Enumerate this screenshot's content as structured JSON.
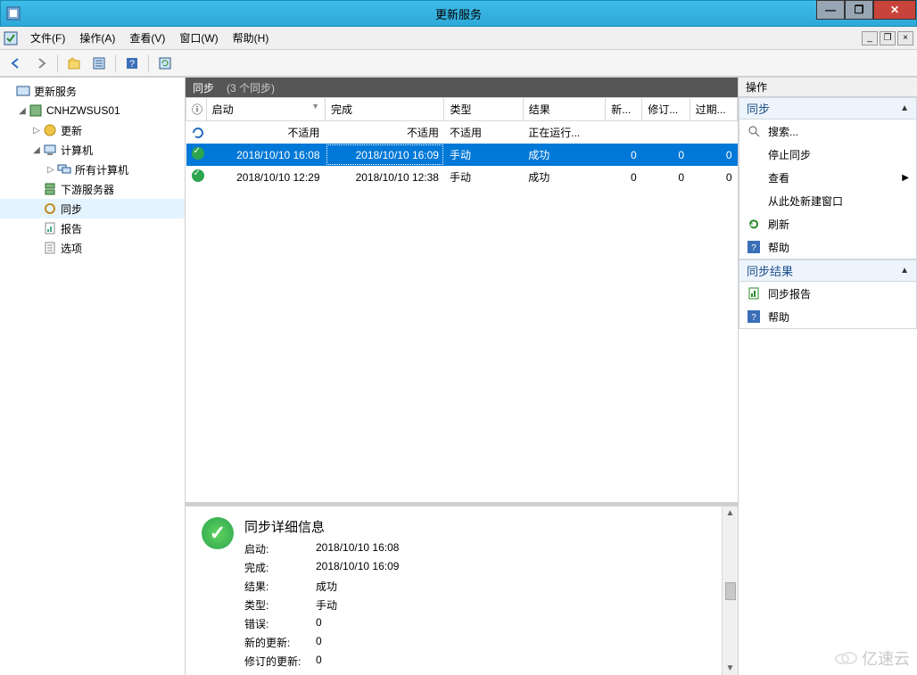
{
  "window": {
    "title": "更新服务",
    "min": "—",
    "max": "❐",
    "close": "✕"
  },
  "menu": {
    "file": "文件(F)",
    "action": "操作(A)",
    "view": "查看(V)",
    "window": "窗口(W)",
    "help": "帮助(H)"
  },
  "tree": {
    "root": "更新服务",
    "server": "CNHZWSUS01",
    "updates": "更新",
    "computers": "计算机",
    "all_computers": "所有计算机",
    "downstream": "下游服务器",
    "sync": "同步",
    "reports": "报告",
    "options": "选项"
  },
  "grid_header": {
    "title": "同步",
    "count": "(3 个同步)"
  },
  "columns": {
    "info": "ⓘ",
    "start": "启动",
    "end": "完成",
    "type": "类型",
    "result": "结果",
    "new": "新...",
    "revised": "修订...",
    "expired": "过期..."
  },
  "rows": [
    {
      "icon": "running",
      "start": "不适用",
      "end": "不适用",
      "type": "不适用",
      "result": "正在运行...",
      "new": "",
      "revised": "",
      "expired": ""
    },
    {
      "icon": "ok",
      "start": "2018/10/10 16:08",
      "end": "2018/10/10 16:09",
      "type": "手动",
      "result": "成功",
      "new": "0",
      "revised": "0",
      "expired": "0",
      "selected": true
    },
    {
      "icon": "ok",
      "start": "2018/10/10 12:29",
      "end": "2018/10/10 12:38",
      "type": "手动",
      "result": "成功",
      "new": "0",
      "revised": "0",
      "expired": "0"
    }
  ],
  "details": {
    "title": "同步详细信息",
    "labels": {
      "start": "启动:",
      "end": "完成:",
      "result": "结果:",
      "type": "类型:",
      "errors": "错误:",
      "new_updates": "新的更新:",
      "revised_updates": "修订的更新:"
    },
    "values": {
      "start": "2018/10/10 16:08",
      "end": "2018/10/10 16:09",
      "result": "成功",
      "type": "手动",
      "errors": "0",
      "new_updates": "0",
      "revised_updates": "0"
    }
  },
  "actions": {
    "panel_title": "操作",
    "section_sync": "同步",
    "search": "搜索...",
    "stop_sync": "停止同步",
    "view": "查看",
    "new_window": "从此处新建窗口",
    "refresh": "刷新",
    "help": "帮助",
    "section_result": "同步结果",
    "sync_report": "同步报告",
    "help2": "帮助"
  },
  "watermark": "亿速云"
}
